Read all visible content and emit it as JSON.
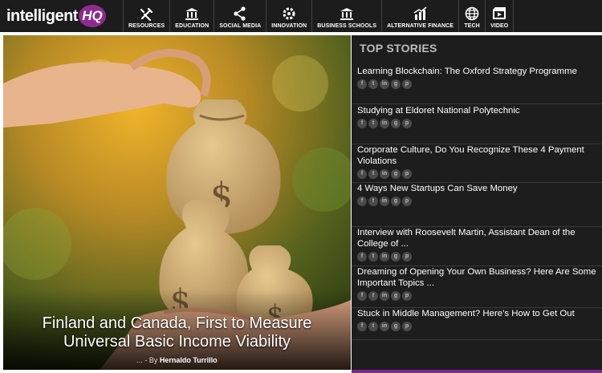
{
  "logo": {
    "text": "intelligent",
    "badge": "HQ"
  },
  "nav": [
    {
      "label": "RESOURCES",
      "icon": "tools-icon"
    },
    {
      "label": "EDUCATION",
      "icon": "institution-icon"
    },
    {
      "label": "SOCIAL MEDIA",
      "icon": "share-icon"
    },
    {
      "label": "INNOVATION",
      "icon": "gear-icon"
    },
    {
      "label": "BUSINESS SCHOOLS",
      "icon": "institution-icon"
    },
    {
      "label": "ALTERNATIVE FINANCE",
      "icon": "chart-icon"
    },
    {
      "label": "TECH",
      "icon": "globe-icon"
    },
    {
      "label": "VIDEO",
      "icon": "film-icon"
    }
  ],
  "hero": {
    "title_line1": "Finland and Canada, First to Measure",
    "title_line2": "Universal Basic Income Viability",
    "byline_prefix": "... - By",
    "author": "Hernaldo Turrillo"
  },
  "top_stories": {
    "heading": "TOP STORIES",
    "items": [
      {
        "title": "Learning Blockchain: The Oxford Strategy Programme"
      },
      {
        "title": "Studying at Eldoret National Polytechnic"
      },
      {
        "title": "Corporate Culture, Do You Recognize These 4 Payment Violations"
      },
      {
        "title": "4 Ways New Startups Can Save Money"
      },
      {
        "title": "Interview with Roosevelt Martin, Assistant Dean of the College of ..."
      },
      {
        "title": "Dreaming of Opening Your Own Business? Here Are Some Important Topics ..."
      },
      {
        "title": "Stuck in Middle Management? Here’s How to Get Out"
      }
    ],
    "share_icons": [
      "f",
      "t",
      "in",
      "g",
      "p"
    ]
  },
  "colors": {
    "accent": "#7b2a8b",
    "nav_bg": "#1c1c1c",
    "panel_bg": "#1d1d1d"
  }
}
